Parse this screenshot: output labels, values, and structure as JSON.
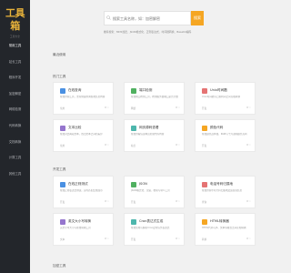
{
  "sidebar": {
    "logo": "工具箱",
    "logo_sub": "工具大全",
    "items": [
      {
        "label": "常用工具"
      },
      {
        "label": "站长工具"
      },
      {
        "label": "程序开发"
      },
      {
        "label": "加密解密"
      },
      {
        "label": "网络检测"
      },
      {
        "label": "代码转换"
      },
      {
        "label": "文档转换"
      },
      {
        "label": "计算工具"
      },
      {
        "label": "其他工具"
      }
    ]
  },
  "search": {
    "placeholder": "搜索工具名称，如：加密解密",
    "button": "搜索",
    "hint": "推荐搜索：MD5加密、JSON格式化、正则表达式、时间戳转换、Base64编码"
  },
  "sections": [
    {
      "title": "最近使用",
      "cards": []
    },
    {
      "title": "热门工具",
      "cards": [
        {
          "title": "在线查询",
          "desc": "在线查询工具，支持快速查询各类信息内容",
          "cat": "常用",
          "meta": "0 ♡",
          "icon_color": "#4a90e2"
        },
        {
          "title": "端口检测",
          "desc": "在线端口检测工具，检测服务器端口是否开放",
          "cat": "网络",
          "meta": "0 ♡",
          "icon_color": "#50b060"
        },
        {
          "title": "Unix时间戳",
          "desc": "Unix时间戳与日期时间之间互相转换",
          "cat": "开发",
          "meta": "0 ♡",
          "icon_color": "#e57373"
        },
        {
          "title": "文本比较",
          "desc": "在线对比两段文本，找出文本之间的差异",
          "cat": "常用",
          "meta": "0 ♡",
          "icon_color": "#9575cd"
        },
        {
          "title": "网页源码查看",
          "desc": "在线查看任意网页的源代码内容",
          "cat": "站长",
          "meta": "0 ♡",
          "icon_color": "#4db6ac"
        },
        {
          "title": "颜色代码",
          "desc": "在线颜色选择器，RGB与十六进制颜色互转",
          "cat": "开发",
          "meta": "0 ♡",
          "icon_color": "#f5a623"
        }
      ]
    },
    {
      "title": "开发工具",
      "cards": [
        {
          "title": "在线正则测试",
          "desc": "在线正则表达式测试，实时匹配结果展示",
          "cat": "开发",
          "meta": "0 ♡",
          "icon_color": "#4a90e2"
        },
        {
          "title": "JSON",
          "desc": "JSON格式化、压缩、校验与转义工具",
          "cat": "开发",
          "meta": "0 ♡",
          "icon_color": "#50b060"
        },
        {
          "title": "电话号码归属地",
          "desc": "在线查询手机号码归属地及运营商信息",
          "cat": "查询",
          "meta": "0 ♡",
          "icon_color": "#e57373"
        },
        {
          "title": "英文大小写转换",
          "desc": "英文字母大小写在线转换工具",
          "cat": "文本",
          "meta": "0 ♡",
          "icon_color": "#9575cd"
        },
        {
          "title": "Cron表达式生成",
          "desc": "在线生成与解析Cron定时任务表达式",
          "cat": "开发",
          "meta": "0 ♡",
          "icon_color": "#4db6ac"
        },
        {
          "title": "HTML转换器",
          "desc": "HTML代码与JS、文本等格式之间互相转换",
          "cat": "转换",
          "meta": "0 ♡",
          "icon_color": "#f5a623"
        }
      ]
    },
    {
      "title": "加密工具",
      "cards": []
    }
  ]
}
